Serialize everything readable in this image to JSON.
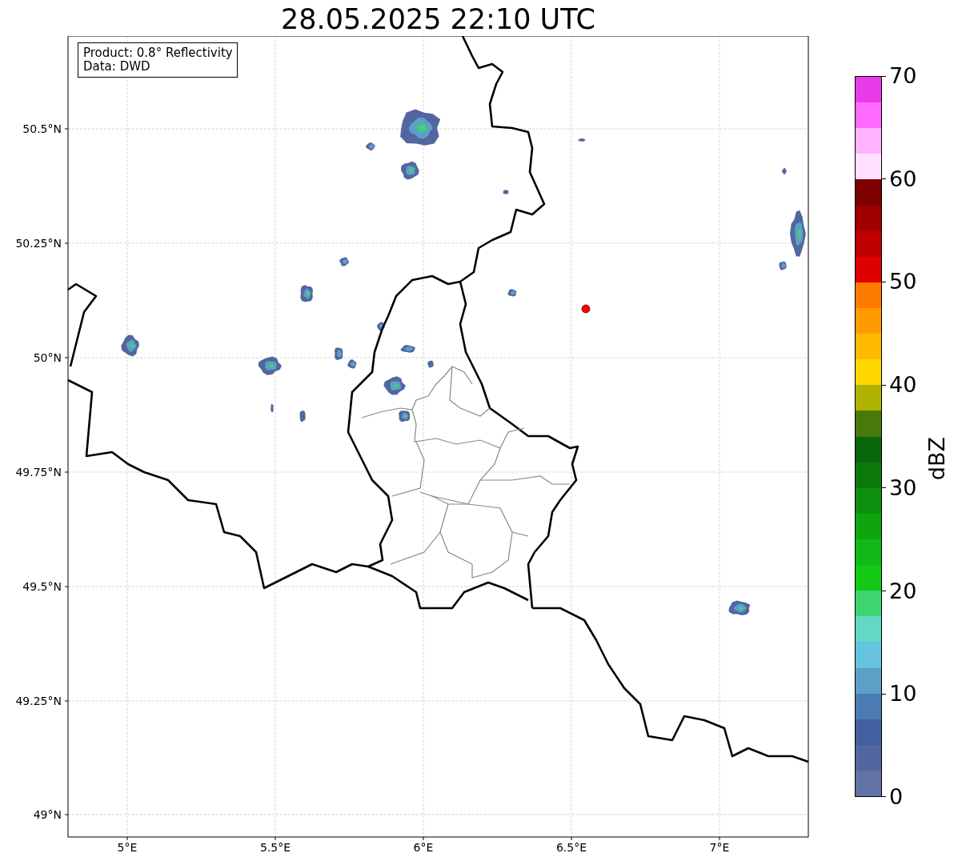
{
  "title": "28.05.2025 22:10 UTC",
  "annotation": [
    "Product: 0.8° Reflectivity",
    "Data: DWD"
  ],
  "map": {
    "x_ticks": [
      "5°E",
      "5.5°E",
      "6°E",
      "6.5°E",
      "7°E"
    ],
    "y_ticks": [
      "50.5°N",
      "50.25°N",
      "50°N",
      "49.75°N",
      "49.5°N",
      "49.25°N",
      "49°N"
    ]
  },
  "colorbar": {
    "label": "dBZ",
    "ticks": [
      "70",
      "60",
      "50",
      "40",
      "30",
      "20",
      "10",
      "0"
    ],
    "bins": [
      {
        "color": "#ea3bea"
      },
      {
        "color": "#ff6bff"
      },
      {
        "color": "#ffb3ff"
      },
      {
        "color": "#ffe0ff"
      },
      {
        "color": "#7c0000"
      },
      {
        "color": "#a00000"
      },
      {
        "color": "#c00000"
      },
      {
        "color": "#e00000"
      },
      {
        "color": "#ff7b00"
      },
      {
        "color": "#ff9b00"
      },
      {
        "color": "#ffba00"
      },
      {
        "color": "#ffd700"
      },
      {
        "color": "#b0b200"
      },
      {
        "color": "#477a0b"
      },
      {
        "color": "#0a640a"
      },
      {
        "color": "#0b7a0b"
      },
      {
        "color": "#0e8f0e"
      },
      {
        "color": "#0fa50f"
      },
      {
        "color": "#10b818"
      },
      {
        "color": "#12c916"
      },
      {
        "color": "#3ed56e"
      },
      {
        "color": "#61d9c4"
      },
      {
        "color": "#66c3dd"
      },
      {
        "color": "#5ca0c8"
      },
      {
        "color": "#4a7bb2"
      },
      {
        "color": "#4460a0"
      },
      {
        "color": "#5366a0"
      },
      {
        "color": "#6473a5"
      }
    ]
  }
}
